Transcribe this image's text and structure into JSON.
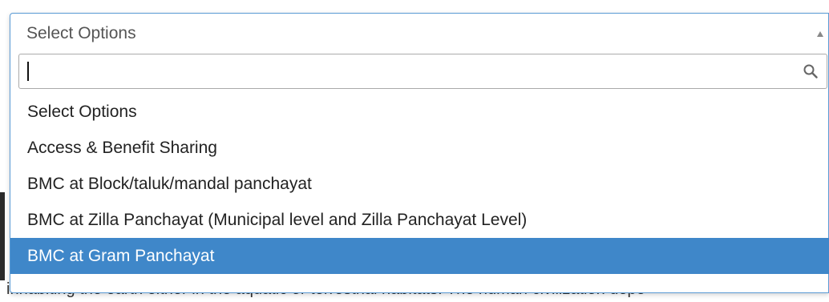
{
  "select": {
    "selected_label": "Select Options",
    "search": {
      "value": "",
      "placeholder": ""
    },
    "options": [
      {
        "label": "Select Options"
      },
      {
        "label": "Access & Benefit Sharing"
      },
      {
        "label": "BMC at Block/taluk/mandal panchayat"
      },
      {
        "label": "BMC at Zilla Panchayat (Municipal level and Zilla Panchayat Level)"
      },
      {
        "label": "BMC at Gram Panchayat",
        "highlighted": true
      }
    ],
    "icons": {
      "arrow": "caret-up-icon",
      "search": "search-icon"
    },
    "colors": {
      "border_focus": "#5b9bd5",
      "highlight": "#3f87c9"
    }
  },
  "background": {
    "partial_text": "inhabiting the earth either in the aquatic or terrestrial habitats. The human civilization depe"
  }
}
